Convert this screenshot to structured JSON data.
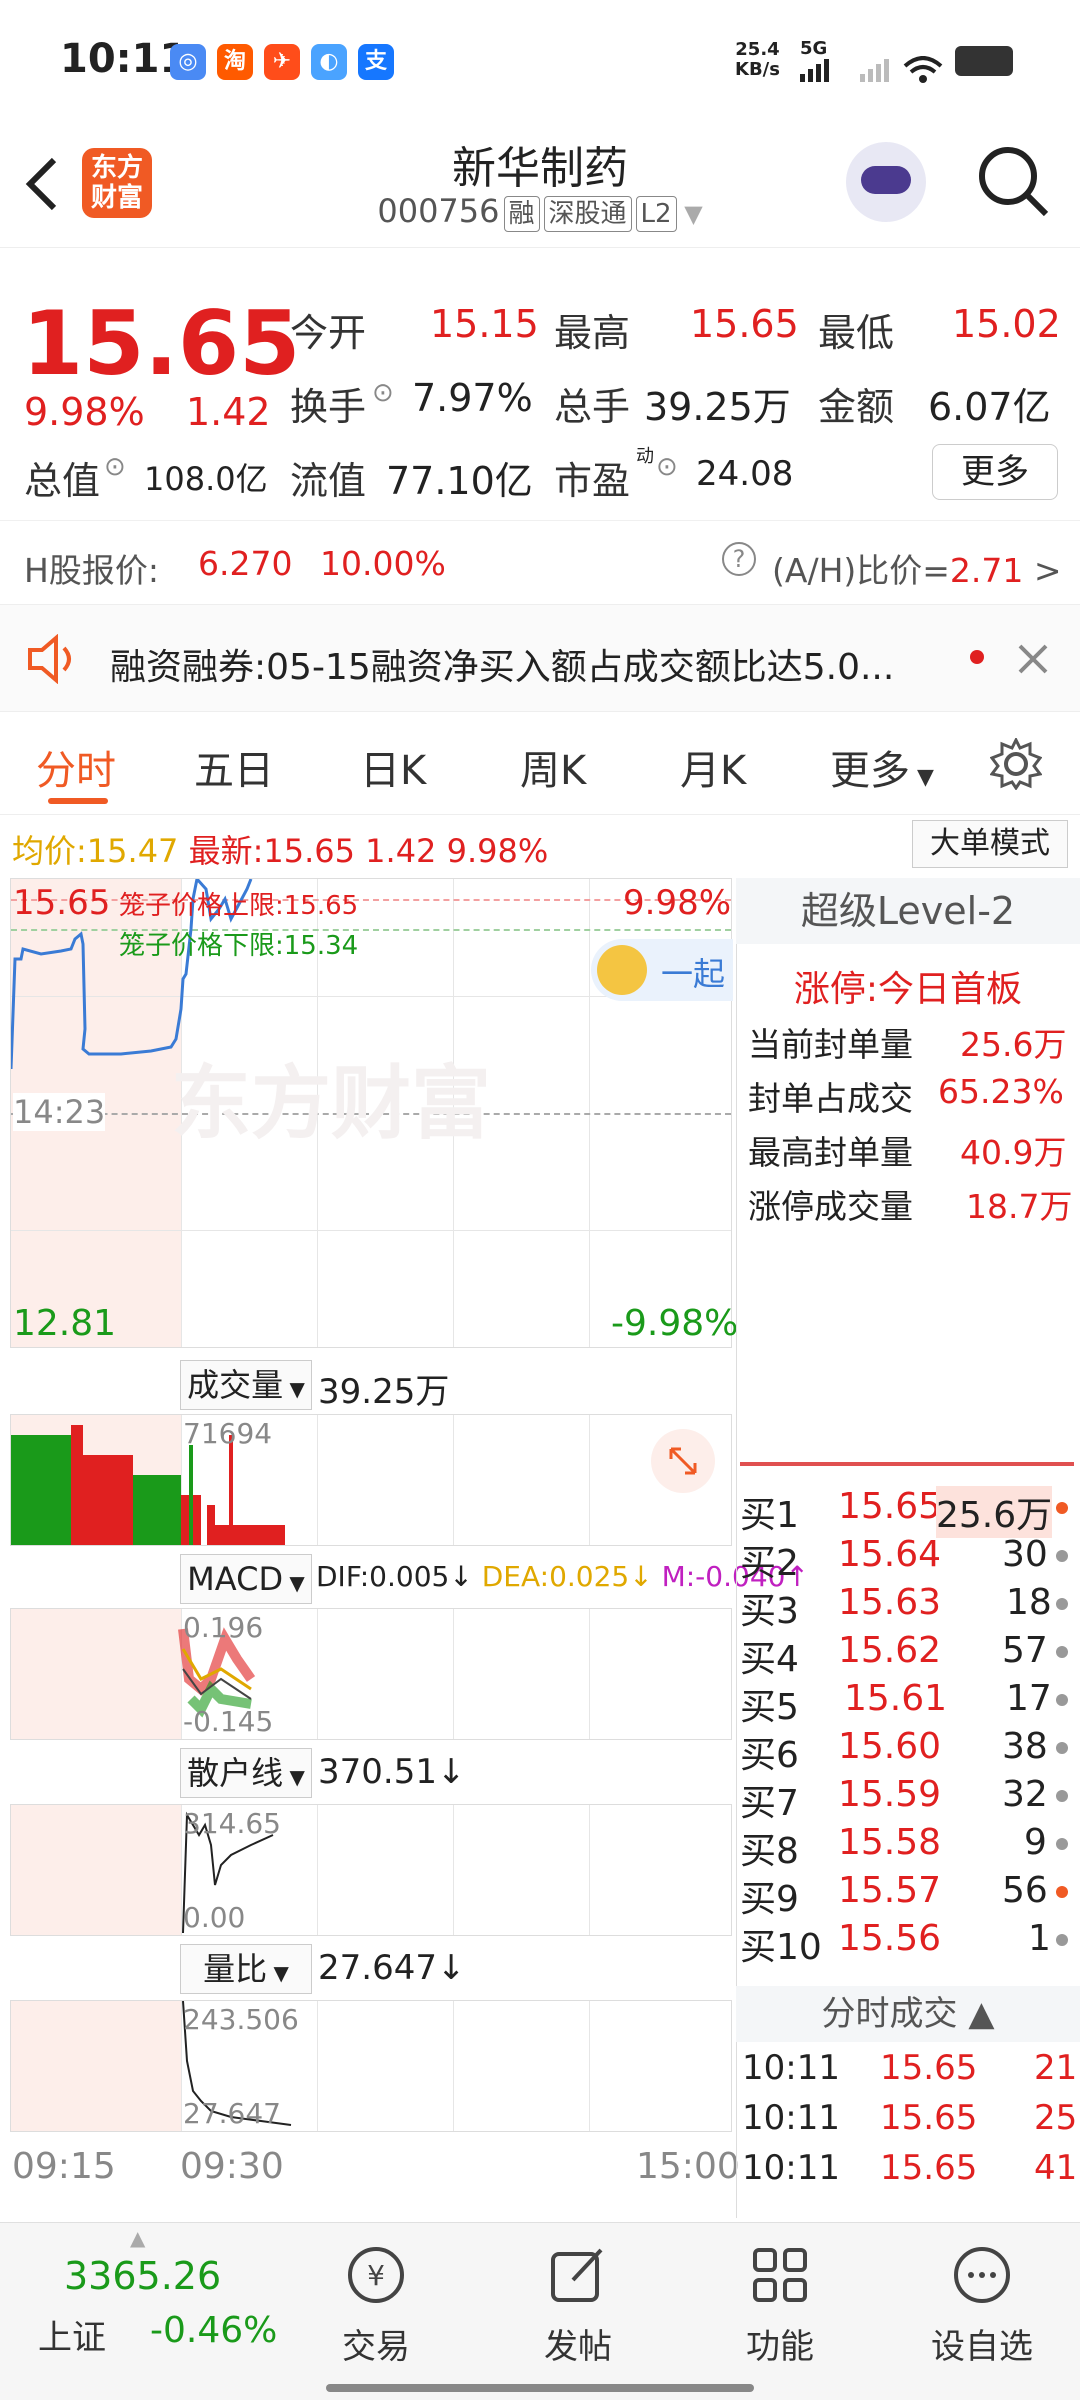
{
  "status_bar": {
    "time": "10:11",
    "net_speed": "25.4",
    "net_unit": "KB/s",
    "signal": "5G"
  },
  "header": {
    "title": "新华制药",
    "code": "000756",
    "tags": [
      "融",
      "深股通",
      "L2"
    ]
  },
  "quote": {
    "price": "15.65",
    "change_pct": "9.98%",
    "change": "1.42",
    "open_label": "今开",
    "open": "15.15",
    "high_label": "最高",
    "high": "15.65",
    "low_label": "最低",
    "low": "15.02",
    "turnover_label": "换手",
    "turnover": "7.97%",
    "volume_label": "总手",
    "volume": "39.25万",
    "amount_label": "金额",
    "amount": "6.07亿",
    "mktcap_label": "总值",
    "mktcap": "108.0亿",
    "float_label": "流值",
    "float": "77.10亿",
    "pe_label": "市盈",
    "pe_sup": "动",
    "pe": "24.08",
    "more": "更多"
  },
  "hshare": {
    "label": "H股报价:",
    "price": "6.270",
    "pct": "10.00%",
    "ratio_label": "(A/H)比价=",
    "ratio": "2.71",
    "arrow": ">"
  },
  "news": {
    "text": "融资融券:05-15融资净买入额占成交额比达5.0..."
  },
  "tabs": [
    "分时",
    "五日",
    "日K",
    "周K",
    "月K",
    "更多"
  ],
  "info_line": {
    "avg_label": "均价:",
    "avg": "15.47",
    "last_label": "最新:",
    "last": "15.65",
    "chg": "1.42",
    "pct": "9.98%",
    "mode_btn": "大单模式"
  },
  "chart": {
    "price_top": "15.65",
    "price_bottom": "12.81",
    "pct_top": "9.98%",
    "pct_bottom": "-9.98%",
    "cage_upper": "笼子价格上限:15.65",
    "cage_lower": "笼子价格下限:15.34",
    "crosshair_time": "14:23",
    "bubble": "一起",
    "volume_label": "成交量",
    "volume_value": "39.25万",
    "volume_max": "71694",
    "macd_label": "MACD",
    "dif": "DIF:0.005↓",
    "dea": "DEA:0.025↓",
    "m": "M:-0.040↑",
    "macd_top": "0.196",
    "macd_bottom": "-0.145",
    "retail_label": "散户线",
    "retail_value": "370.51↓",
    "retail_top": "314.65",
    "retail_bottom": "0.00",
    "ratio_label": "量比",
    "ratio_value": "27.647↓",
    "ratio_top": "243.506",
    "ratio_bottom": "27.647",
    "times": [
      "09:15",
      "09:30",
      "15:00"
    ],
    "watermark": "东方财富"
  },
  "level2": {
    "title": "超级Level-2",
    "limit": "涨停:今日首板",
    "rows": [
      {
        "label": "当前封单量",
        "value": "25.6万"
      },
      {
        "label": "封单占成交",
        "value": "65.23%"
      },
      {
        "label": "最高封单量",
        "value": "40.9万"
      },
      {
        "label": "涨停成交量",
        "value": "18.7万"
      }
    ]
  },
  "orderbook": [
    {
      "label": "买1",
      "price": "15.65",
      "qty": "25.6万",
      "dot": "orange"
    },
    {
      "label": "买2",
      "price": "15.64",
      "qty": "30",
      "dot": "gray"
    },
    {
      "label": "买3",
      "price": "15.63",
      "qty": "18",
      "dot": "gray"
    },
    {
      "label": "买4",
      "price": "15.62",
      "qty": "57",
      "dot": "gray"
    },
    {
      "label": "买5",
      "price": "15.61",
      "qty": "17",
      "dot": "gray"
    },
    {
      "label": "买6",
      "price": "15.60",
      "qty": "38",
      "dot": "gray"
    },
    {
      "label": "买7",
      "price": "15.59",
      "qty": "32",
      "dot": "gray"
    },
    {
      "label": "买8",
      "price": "15.58",
      "qty": "9",
      "dot": "gray"
    },
    {
      "label": "买9",
      "price": "15.57",
      "qty": "56",
      "dot": "orange"
    },
    {
      "label": "买10",
      "price": "15.56",
      "qty": "1",
      "dot": "gray"
    }
  ],
  "trades_title": "分时成交",
  "trades": [
    {
      "time": "10:11",
      "price": "15.65",
      "qty": "21"
    },
    {
      "time": "10:11",
      "price": "15.65",
      "qty": "25"
    },
    {
      "time": "10:11",
      "price": "15.65",
      "qty": "41"
    }
  ],
  "bottom": {
    "index_value": "3365.26",
    "index_name": "上证",
    "index_pct": "-0.46%",
    "nav": [
      "交易",
      "发帖",
      "功能",
      "设自选"
    ]
  },
  "colors": {
    "up": "#e02020",
    "down": "#1a9a1a",
    "accent": "#f05a24",
    "line": "#3a7bd5"
  }
}
